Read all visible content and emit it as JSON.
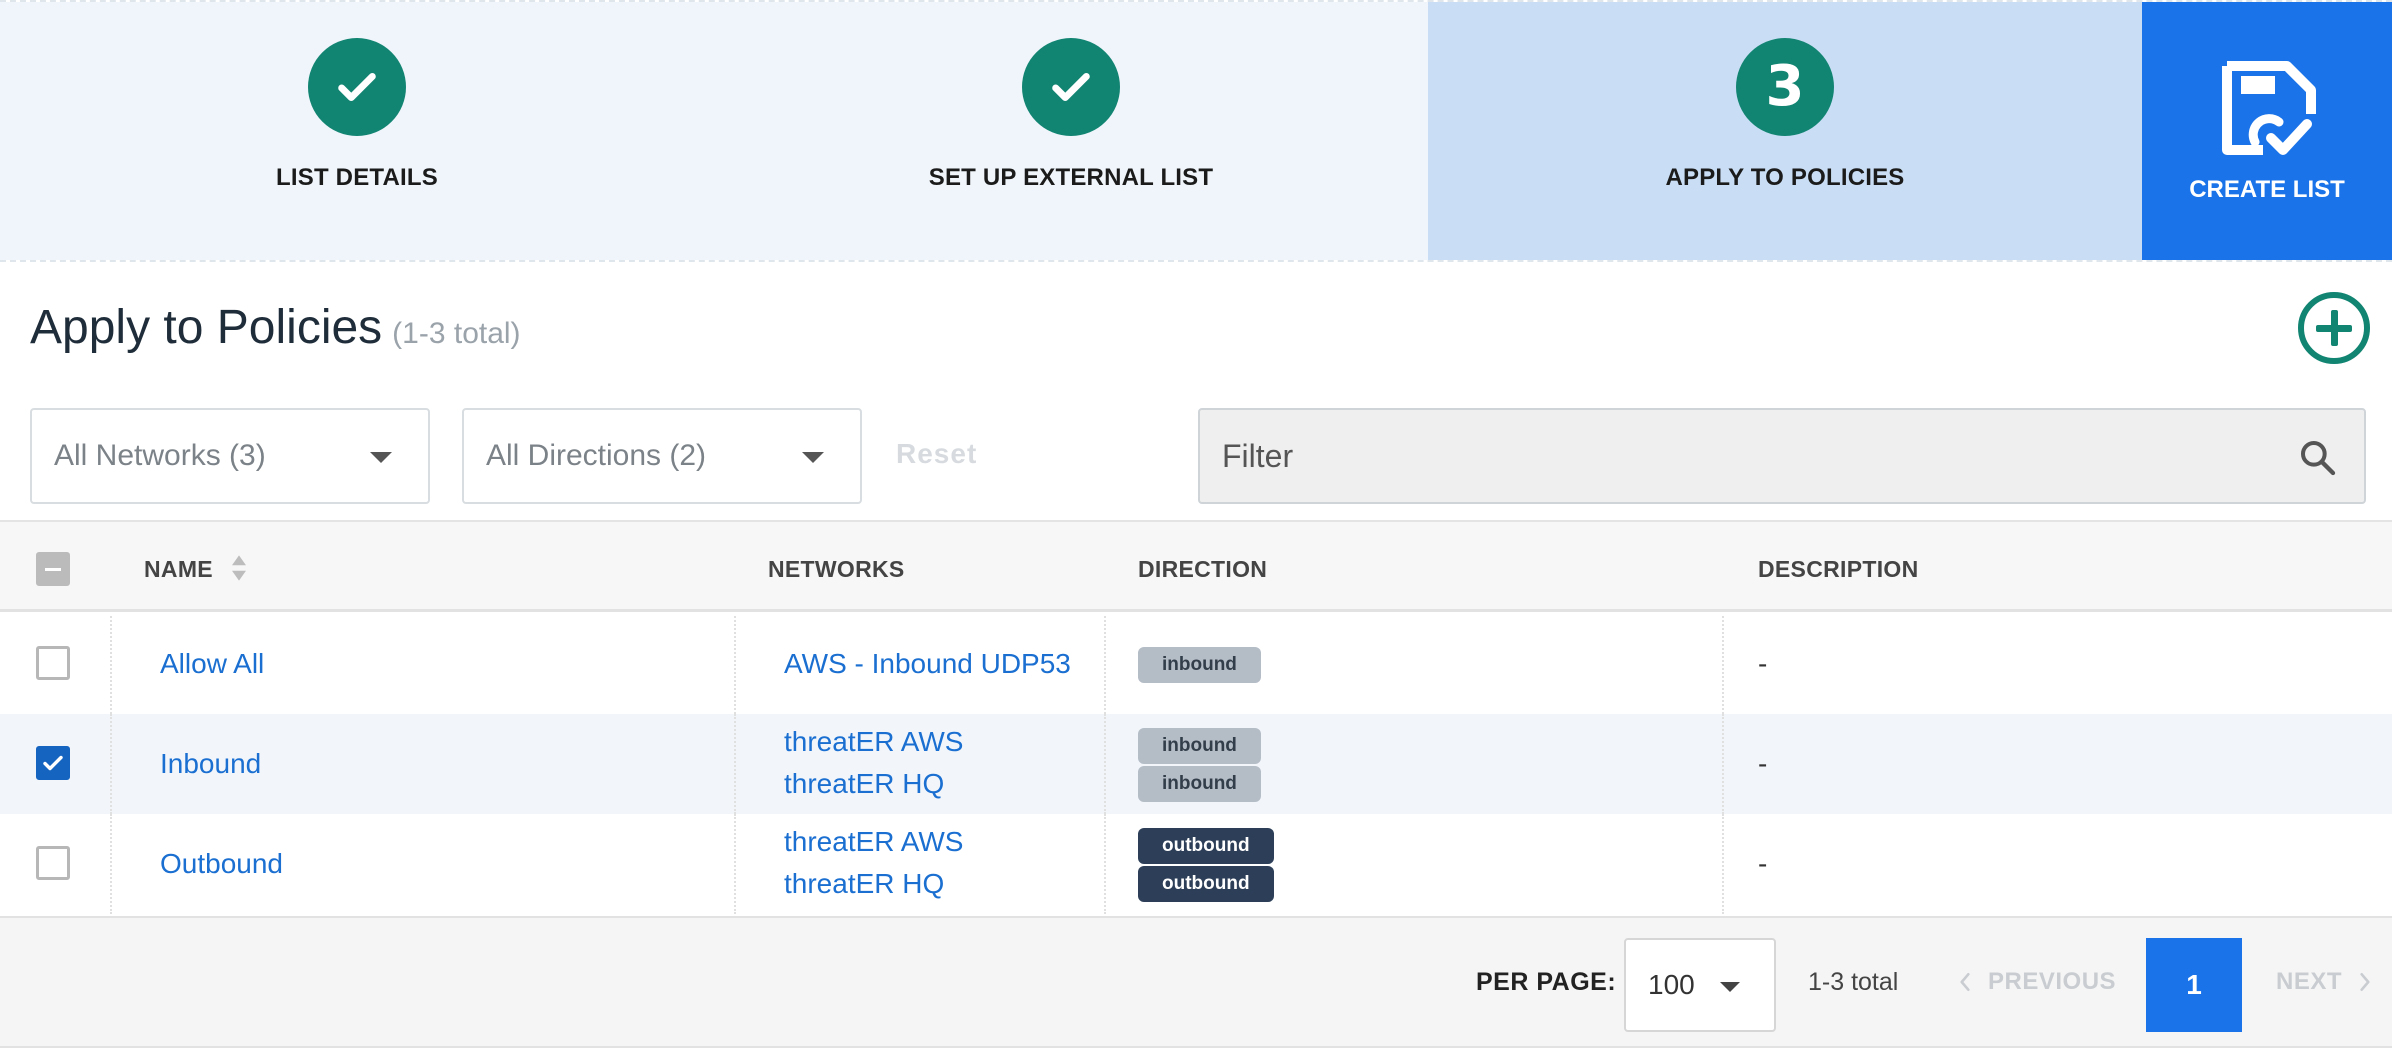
{
  "stepper": {
    "steps": [
      {
        "label": "LIST DETAILS",
        "state": "complete"
      },
      {
        "label": "SET UP EXTERNAL LIST",
        "state": "complete"
      },
      {
        "label": "APPLY TO POLICIES",
        "state": "active",
        "number": "3"
      }
    ],
    "create_label": "CREATE LIST",
    "colors": {
      "complete": "#128472",
      "active_bg": "#c9def4",
      "primary": "#1a73e8"
    }
  },
  "section": {
    "title": "Apply to Policies",
    "count": "(1-3 total)",
    "add_icon": "plus-circle-icon"
  },
  "filters": {
    "networks": "All Networks (3)",
    "directions": "All Directions (2)",
    "reset_label": "Reset",
    "filter_placeholder": "Filter",
    "search_icon": "search-icon"
  },
  "table": {
    "columns": {
      "name": "NAME",
      "networks": "NETWORKS",
      "direction": "DIRECTION",
      "description": "DESCRIPTION"
    },
    "select_all_state": "indeterminate",
    "rows": [
      {
        "name": "Allow All",
        "checked": false,
        "networks": [
          "AWS - Inbound UDP53"
        ],
        "directions": [
          "inbound"
        ],
        "description": "-"
      },
      {
        "name": "Inbound",
        "checked": true,
        "networks": [
          "threatER AWS",
          "threatER HQ"
        ],
        "directions": [
          "inbound",
          "inbound"
        ],
        "description": "-"
      },
      {
        "name": "Outbound",
        "checked": false,
        "networks": [
          "threatER AWS",
          "threatER HQ"
        ],
        "directions": [
          "outbound",
          "outbound"
        ],
        "description": "-"
      }
    ]
  },
  "pagination": {
    "per_page_label": "PER PAGE:",
    "per_page_value": "100",
    "total": "1-3 total",
    "previous": "PREVIOUS",
    "next": "NEXT",
    "current_page": "1"
  }
}
